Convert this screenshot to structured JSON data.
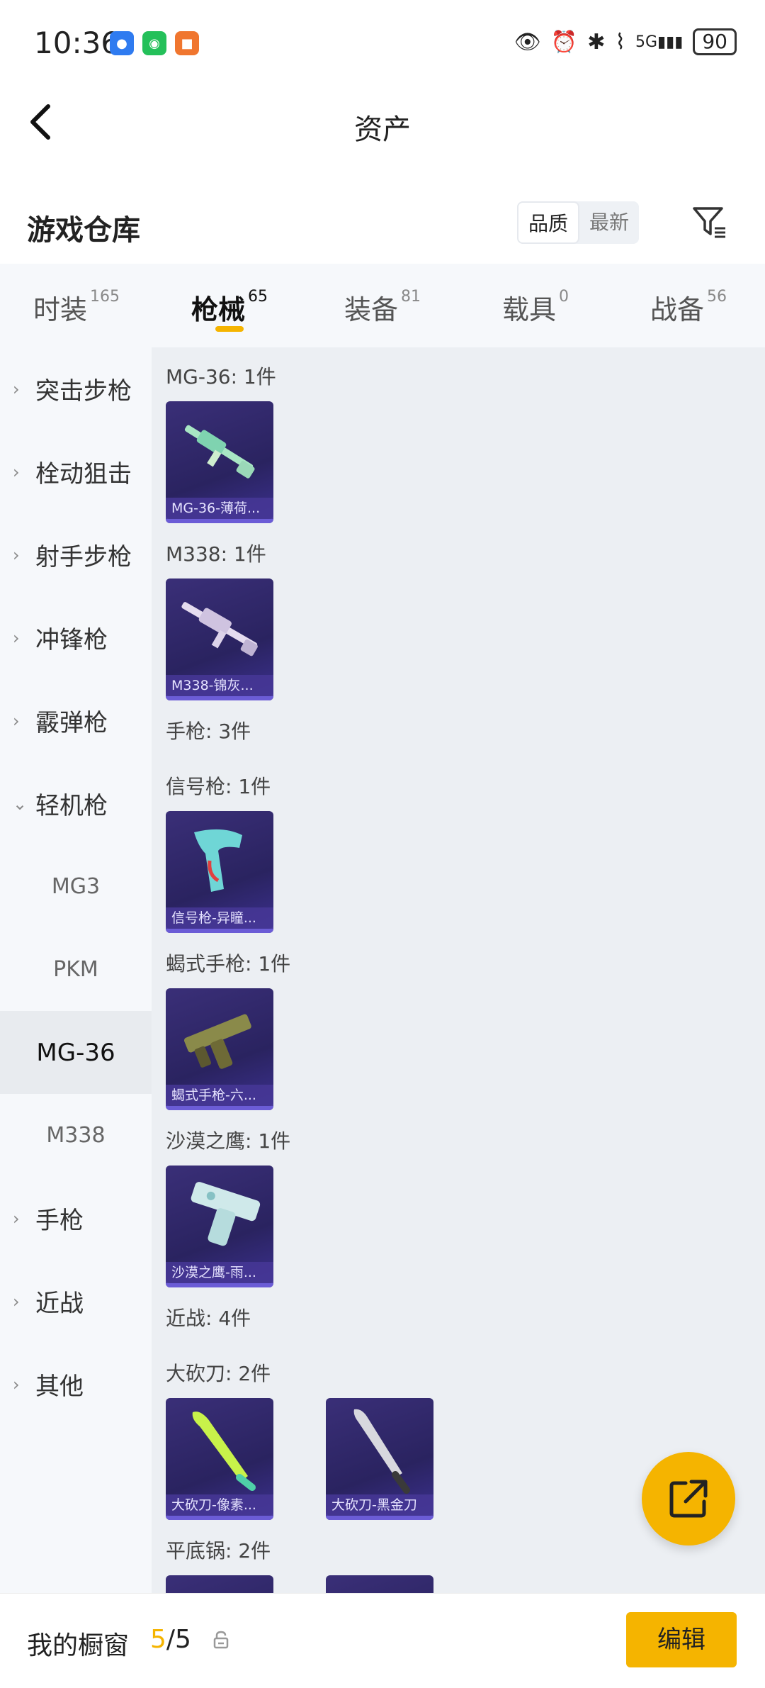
{
  "status_bar": {
    "time": "10:36",
    "battery": "90",
    "network": "5G"
  },
  "header": {
    "title": "资产"
  },
  "section": {
    "title": "游戏仓库",
    "sort_options": [
      "品质",
      "最新"
    ]
  },
  "tabs": [
    {
      "label": "时装",
      "count": "165"
    },
    {
      "label": "枪械",
      "count": "65"
    },
    {
      "label": "装备",
      "count": "81"
    },
    {
      "label": "载具",
      "count": "0"
    },
    {
      "label": "战备",
      "count": "56"
    }
  ],
  "sidebar": {
    "categories": [
      "突击步枪",
      "栓动狙击",
      "射手步枪",
      "冲锋枪",
      "霰弹枪",
      "轻机枪"
    ],
    "subitems": [
      "MG3",
      "PKM",
      "MG-36",
      "M338"
    ],
    "more": [
      "手枪",
      "近战",
      "其他"
    ]
  },
  "content": {
    "groups": [
      {
        "label": "MG-36: 1件",
        "items": [
          "MG-36-薄荷..."
        ]
      },
      {
        "label": "M338: 1件",
        "items": [
          "M338-锦灰..."
        ]
      },
      {
        "label": "手枪: 3件"
      },
      {
        "label": "信号枪: 1件",
        "items": [
          "信号枪-异瞳..."
        ]
      },
      {
        "label": "蝎式手枪: 1件",
        "items": [
          "蝎式手枪-六..."
        ]
      },
      {
        "label": "沙漠之鹰: 1件",
        "items": [
          "沙漠之鹰-雨..."
        ]
      },
      {
        "label": "近战: 4件"
      },
      {
        "label": "大砍刀: 2件",
        "items": [
          "大砍刀-像素...",
          "大砍刀-黑金刀"
        ]
      },
      {
        "label": "平底锅: 2件"
      }
    ]
  },
  "bottom_bar": {
    "window_label": "我的橱窗",
    "current": "5",
    "slash_total": "/5",
    "edit_label": "编辑"
  },
  "colors": {
    "accent": "#f5b400",
    "card_bg": "#2f2766"
  }
}
